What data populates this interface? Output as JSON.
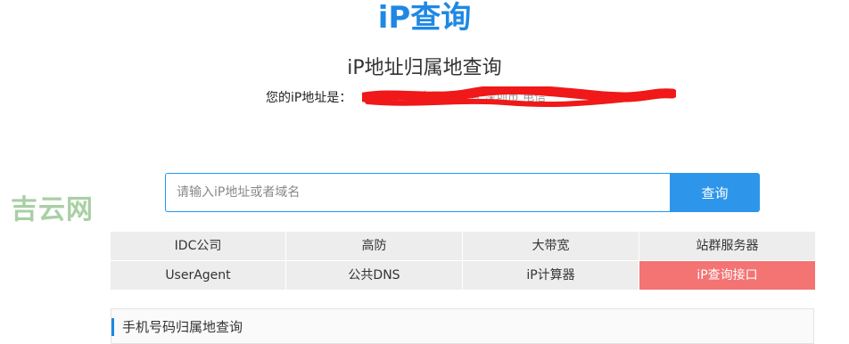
{
  "header": {
    "logo": "iP查询",
    "title": "iP地址归属地查询"
  },
  "ip_info": {
    "label": "您的iP地址是：",
    "masked_value": "[1.1.1.1] 中国 广东省 深圳市 电信"
  },
  "watermark": "吉云网",
  "search": {
    "placeholder": "请输入iP地址或者域名",
    "button_label": "查询",
    "accent_color": "#2e96ea"
  },
  "links": [
    {
      "label": "IDC公司"
    },
    {
      "label": "高防"
    },
    {
      "label": "大带宽"
    },
    {
      "label": "站群服务器"
    },
    {
      "label": "UserAgent"
    },
    {
      "label": "公共DNS"
    },
    {
      "label": "iP计算器"
    },
    {
      "label": "iP查询接口",
      "active": true
    }
  ],
  "active_color": "#f47373",
  "section": {
    "title": "手机号码归属地查询"
  }
}
